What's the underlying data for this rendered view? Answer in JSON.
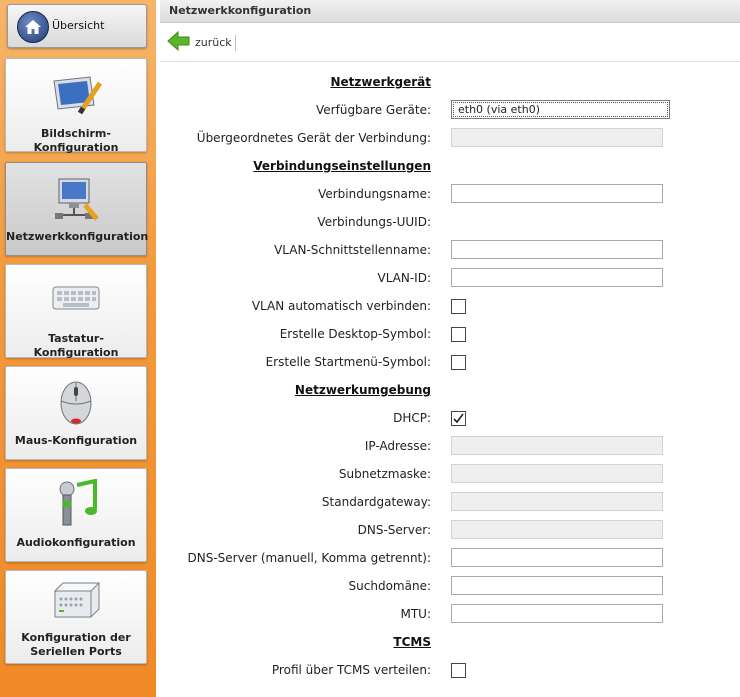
{
  "sidebar": {
    "overview_label": "Übersicht",
    "items": [
      {
        "label": "Bildschirm-Konfiguration",
        "icon": "monitor-pen-icon"
      },
      {
        "label": "Netzwerkkonfiguration",
        "icon": "network-monitor-icon"
      },
      {
        "label": "Tastatur-Konfiguration",
        "icon": "keyboard-icon"
      },
      {
        "label": "Maus-Konfiguration",
        "icon": "mouse-icon"
      },
      {
        "label": "Audiokonfiguration",
        "icon": "microphone-music-icon"
      },
      {
        "label_line1": "Konfiguration der",
        "label_line2": "Seriellen Ports",
        "icon": "serial-device-icon"
      }
    ],
    "active_index": 1
  },
  "header": {
    "title": "Netzwerkkonfiguration"
  },
  "toolbar": {
    "back_label": "zurück"
  },
  "form": {
    "sec_device": "Netzwerkgerät",
    "available_devices_label": "Verfügbare Geräte:",
    "available_devices_value": "eth0 (via eth0)",
    "parent_device_label": "Übergeordnetes Gerät der Verbindung:",
    "sec_connection": "Verbindungseinstellungen",
    "connection_name_label": "Verbindungsname:",
    "connection_uuid_label": "Verbindungs-UUID:",
    "vlan_interface_label": "VLAN-Schnittstellenname:",
    "vlan_id_label": "VLAN-ID:",
    "vlan_auto_label": "VLAN automatisch verbinden:",
    "desktop_symbol_label": "Erstelle Desktop-Symbol:",
    "startmenu_symbol_label": "Erstelle Startmenü-Symbol:",
    "sec_environment": "Netzwerkumgebung",
    "dhcp_label": "DHCP:",
    "ip_label": "IP-Adresse:",
    "subnet_label": "Subnetzmaske:",
    "gateway_label": "Standardgateway:",
    "dns_label": "DNS-Server:",
    "dns_manual_label": "DNS-Server (manuell, Komma getrennt):",
    "search_domain_label": "Suchdomäne:",
    "mtu_label": "MTU:",
    "sec_tcms": "TCMS",
    "tcms_profile_label": "Profil über TCMS verteilen:",
    "checked": {
      "vlan_auto": false,
      "desktop_symbol": false,
      "startmenu_symbol": false,
      "dhcp": true,
      "tcms_profile": false
    }
  },
  "colors": {
    "sidebar_orange": "#f39a3c",
    "back_arrow_green": "#5ab52a"
  }
}
